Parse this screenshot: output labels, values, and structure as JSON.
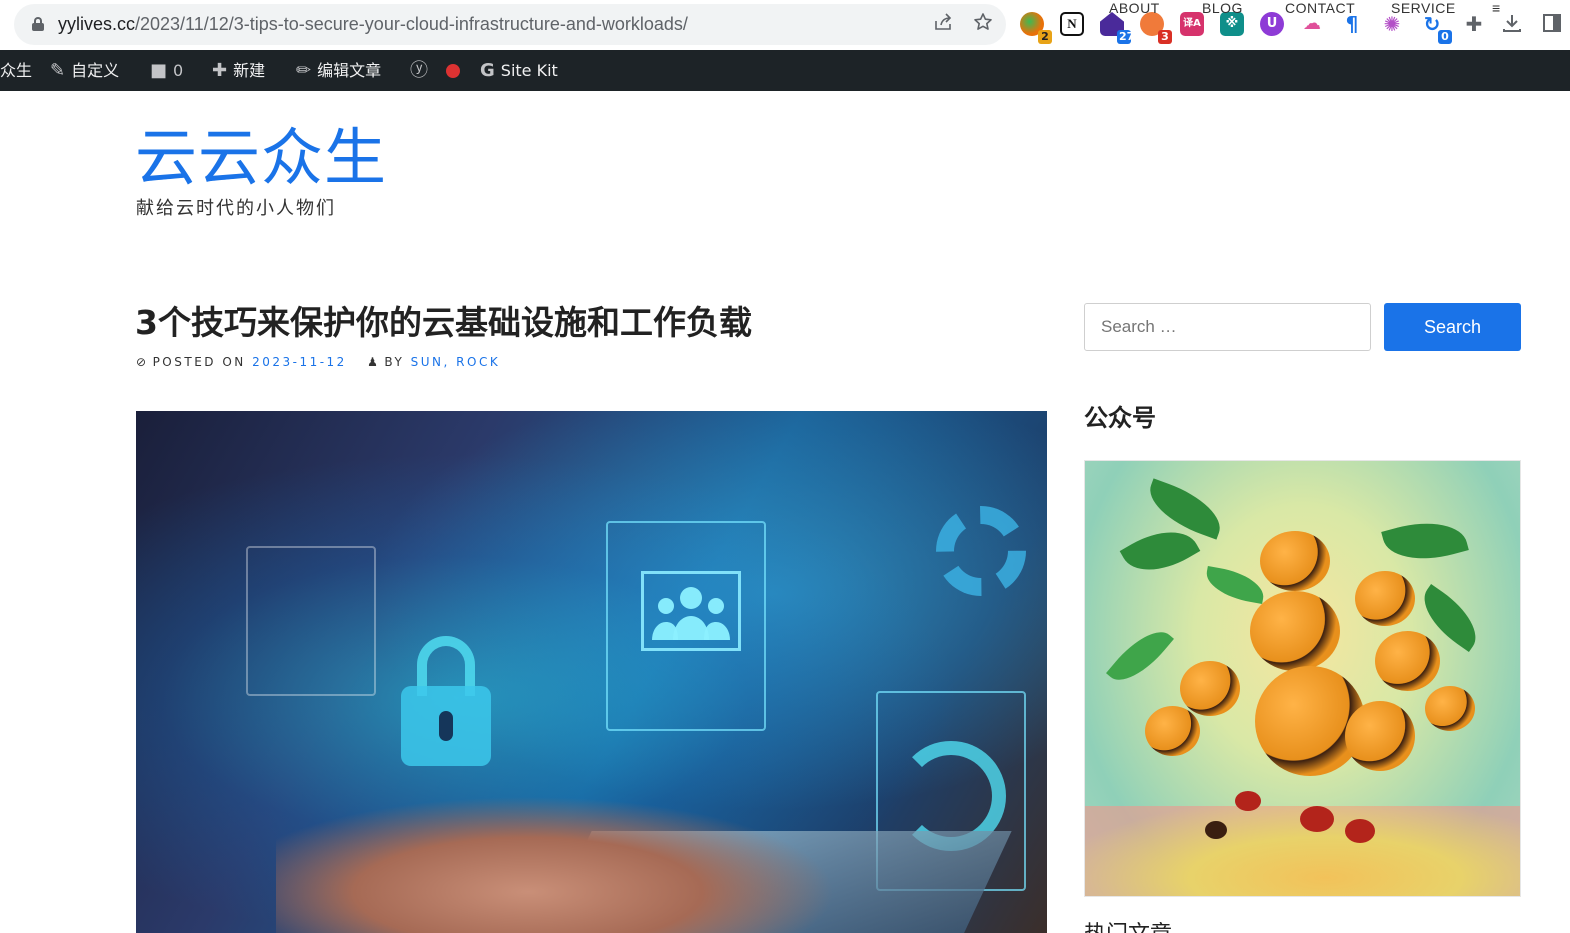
{
  "browser": {
    "url_domain": "yylives.cc",
    "url_path": "/2023/11/12/3-tips-to-secure-your-cloud-infrastructure-and-workloads/",
    "extensions": [
      {
        "name": "ext-1",
        "badge": "2",
        "color": "#e8710a",
        "badge_color": "#e8a317"
      },
      {
        "name": "notion",
        "badge": "",
        "color": "#111111"
      },
      {
        "name": "ext-3",
        "badge": "27",
        "color": "#4a2a9a",
        "badge_color": "#1a73e8"
      },
      {
        "name": "ext-4",
        "badge": "3",
        "color": "#f07a3a",
        "badge_color": "#d93025"
      },
      {
        "name": "ext-5",
        "badge": "",
        "color": "#d6336c"
      },
      {
        "name": "ext-6",
        "badge": "",
        "color": "#0f8f8a"
      },
      {
        "name": "ext-7",
        "badge": "",
        "color": "#8e3bd6"
      },
      {
        "name": "ext-8",
        "badge": "",
        "color": "#e0509a"
      },
      {
        "name": "ext-9",
        "badge": "",
        "color": "#1a73e8"
      },
      {
        "name": "ext-10",
        "badge": "",
        "color": "#b34fc7"
      },
      {
        "name": "ext-11",
        "badge": "0",
        "color": "#1a73e8",
        "badge_color": "#1a73e8"
      }
    ]
  },
  "adminbar": {
    "site_name": "众生",
    "customize": "自定义",
    "comments_count": "0",
    "new": "新建",
    "edit_post": "编辑文章",
    "site_kit": "Site Kit"
  },
  "site": {
    "title": "云云众生",
    "tagline": "献给云时代的小人物们"
  },
  "nav": {
    "items": [
      "ABOUT",
      "BLOG",
      "CONTACT",
      "SERVICE"
    ],
    "menu_icon": "≡"
  },
  "post": {
    "title": "3个技巧来保护你的云基础设施和工作负载",
    "posted_on_label": "POSTED ON",
    "date": "2023-11-12",
    "by_label": "BY",
    "authors": "SUN, ROCK"
  },
  "sidebar": {
    "search_placeholder": "Search …",
    "search_button": "Search",
    "widget_title": "公众号",
    "next_widget_title": "热门文章"
  },
  "colors": {
    "accent": "#1a73e8",
    "adminbar_bg": "#1d2327"
  }
}
